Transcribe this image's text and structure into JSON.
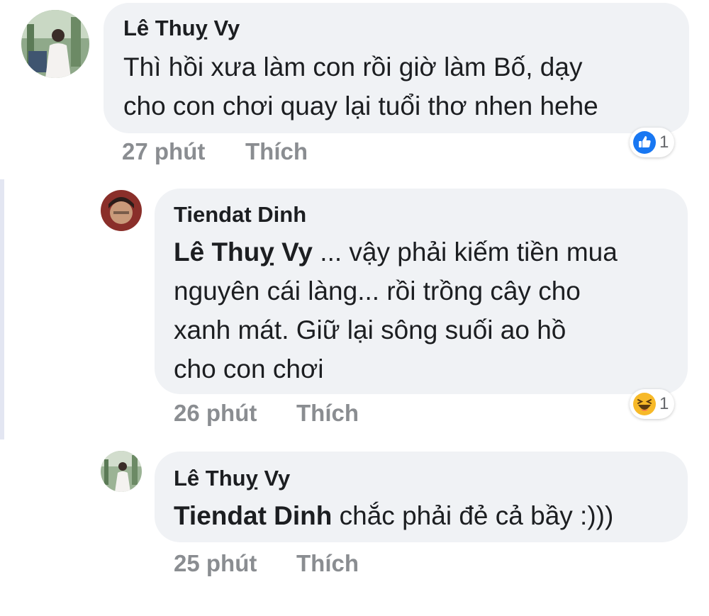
{
  "comments": [
    {
      "author": "Lê Thuỵ Vy",
      "lines": [
        "Thì hồi xưa làm con rồi giờ làm Bố, dạy",
        "cho con chơi quay lại tuổi thơ nhen hehe"
      ],
      "time": "27 phút",
      "like_label": "Thích",
      "reaction": {
        "icon": "like-icon",
        "count": "1"
      }
    },
    {
      "author": "Tiendat Dinh",
      "mention": "Lê Thuỵ Vy",
      "first_line_rest": " ... vậy phải kiếm tiền mua",
      "lines": [
        "nguyên cái làng... rồi trồng cây cho",
        "xanh mát. Giữ lại sông suối ao hồ",
        "cho con chơi"
      ],
      "time": "26 phút",
      "like_label": "Thích",
      "reaction": {
        "icon": "haha-icon",
        "count": "1"
      }
    },
    {
      "author": "Lê Thuỵ Vy",
      "mention": "Tiendat Dinh",
      "first_line_rest": " chắc phải đẻ cả bầy :)))",
      "time": "25 phút",
      "like_label": "Thích"
    }
  ],
  "colors": {
    "bubble": "#f0f2f5",
    "meta": "#8a8d91",
    "like_blue": "#1877f2",
    "haha_yellow": "#f7b928"
  }
}
